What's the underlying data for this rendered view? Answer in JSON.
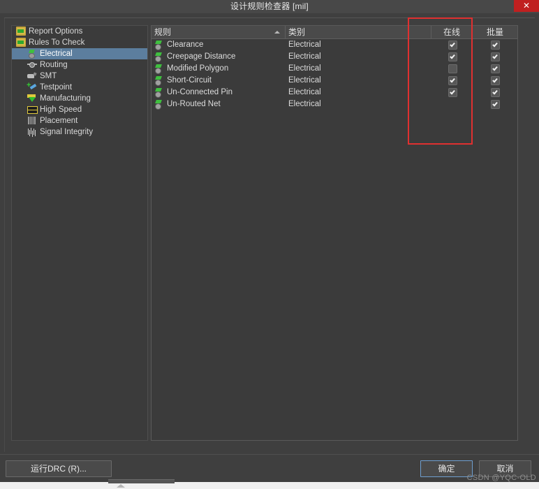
{
  "window": {
    "title": "设计规则检查器 [mil]",
    "close_label": "✕"
  },
  "sidebar": {
    "items": [
      {
        "label": "Report Options",
        "icon": "folder-icon",
        "level": 0,
        "selected": false
      },
      {
        "label": "Rules To Check",
        "icon": "folder-icon",
        "level": 0,
        "selected": false
      },
      {
        "label": "Electrical",
        "icon": "electrical-icon",
        "level": 1,
        "selected": true
      },
      {
        "label": "Routing",
        "icon": "routing-icon",
        "level": 1,
        "selected": false
      },
      {
        "label": "SMT",
        "icon": "smt-icon",
        "level": 1,
        "selected": false
      },
      {
        "label": "Testpoint",
        "icon": "testpoint-icon",
        "level": 1,
        "selected": false
      },
      {
        "label": "Manufacturing",
        "icon": "manufacturing-icon",
        "level": 1,
        "selected": false
      },
      {
        "label": "High Speed",
        "icon": "high-speed-icon",
        "level": 1,
        "selected": false
      },
      {
        "label": "Placement",
        "icon": "placement-icon",
        "level": 1,
        "selected": false
      },
      {
        "label": "Signal Integrity",
        "icon": "signal-integrity-icon",
        "level": 1,
        "selected": false
      }
    ]
  },
  "table": {
    "columns": [
      {
        "key": "rule",
        "label": "规则",
        "sorted": true,
        "sort_dir": "asc"
      },
      {
        "key": "category",
        "label": "类别"
      },
      {
        "key": "spacer",
        "label": ""
      },
      {
        "key": "online",
        "label": "在线"
      },
      {
        "key": "batch",
        "label": "批量"
      }
    ],
    "rows": [
      {
        "rule": "Clearance",
        "category": "Electrical",
        "online": true,
        "batch": true
      },
      {
        "rule": "Creepage Distance",
        "category": "Electrical",
        "online": true,
        "batch": true
      },
      {
        "rule": "Modified Polygon",
        "category": "Electrical",
        "online": false,
        "batch": true
      },
      {
        "rule": "Short-Circuit",
        "category": "Electrical",
        "online": true,
        "batch": true
      },
      {
        "rule": "Un-Connected Pin",
        "category": "Electrical",
        "online": true,
        "batch": true
      },
      {
        "rule": "Un-Routed Net",
        "category": "Electrical",
        "online": null,
        "batch": true
      }
    ]
  },
  "footer": {
    "run_drc_label": "运行DRC (R)...",
    "ok_label": "确定",
    "cancel_label": "取消"
  },
  "annotation": {
    "color": "#e03030",
    "target_column": "在线"
  },
  "watermark": {
    "text": "CSDN @YQC-OLD"
  }
}
